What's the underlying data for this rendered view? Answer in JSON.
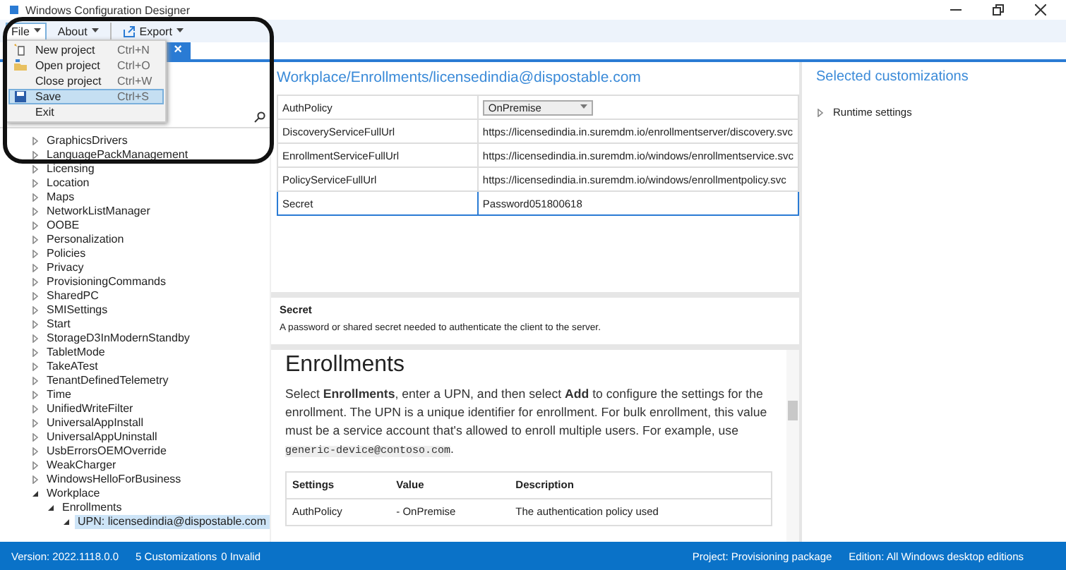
{
  "window": {
    "title": "Windows Configuration Designer"
  },
  "menu_bar": [
    {
      "label": "File",
      "selected": true
    },
    {
      "label": "About",
      "selected": false
    },
    {
      "label": "Export",
      "selected": false
    }
  ],
  "file_menu": [
    {
      "label": "New project",
      "shortcut": "Ctrl+N",
      "selected": false
    },
    {
      "label": "Open project",
      "shortcut": "Ctrl+O",
      "selected": false
    },
    {
      "label": "Close project",
      "shortcut": "Ctrl+W",
      "selected": false
    },
    {
      "label": "Save",
      "shortcut": "Ctrl+S",
      "selected": true
    },
    {
      "label": "Exit",
      "selected": false
    }
  ],
  "tab": {
    "close": "×"
  },
  "tree": [
    {
      "label": "GraphicsDrivers",
      "expanded": false
    },
    {
      "label": "LanguagePackManagement",
      "expanded": false
    },
    {
      "label": "Licensing",
      "expanded": false
    },
    {
      "label": "Location",
      "expanded": false
    },
    {
      "label": "Maps",
      "expanded": false
    },
    {
      "label": "NetworkListManager",
      "expanded": false
    },
    {
      "label": "OOBE",
      "expanded": false
    },
    {
      "label": "Personalization",
      "expanded": false
    },
    {
      "label": "Policies",
      "expanded": false
    },
    {
      "label": "Privacy",
      "expanded": false
    },
    {
      "label": "ProvisioningCommands",
      "expanded": false
    },
    {
      "label": "SharedPC",
      "expanded": false
    },
    {
      "label": "SMISettings",
      "expanded": false
    },
    {
      "label": "Start",
      "expanded": false
    },
    {
      "label": "StorageD3InModernStandby",
      "expanded": false
    },
    {
      "label": "TabletMode",
      "expanded": false
    },
    {
      "label": "TakeATest",
      "expanded": false
    },
    {
      "label": "TenantDefinedTelemetry",
      "expanded": false
    },
    {
      "label": "Time",
      "expanded": false
    },
    {
      "label": "UnifiedWriteFilter",
      "expanded": false
    },
    {
      "label": "UniversalAppInstall",
      "expanded": false
    },
    {
      "label": "UniversalAppUninstall",
      "expanded": false
    },
    {
      "label": "UsbErrorsOEMOverride",
      "expanded": false
    },
    {
      "label": "WeakCharger",
      "expanded": false
    },
    {
      "label": "WindowsHelloForBusiness",
      "expanded": false
    },
    {
      "label": "Workplace",
      "expanded": true,
      "children": [
        {
          "label": "Enrollments",
          "expanded": true,
          "children": [
            {
              "label": "UPN: licensedindia@dispostable.com",
              "expanded": true,
              "selected": true
            }
          ]
        }
      ]
    }
  ],
  "settings": {
    "path": "Workplace/Enrollments/licensedindia@dispostable.com",
    "rows": [
      {
        "name": "AuthPolicy",
        "value": "OnPremise",
        "kind": "dropdown",
        "selected": false
      },
      {
        "name": "DiscoveryServiceFullUrl",
        "value": "https://licensedindia.in.suremdm.io/enrollmentserver/discovery.svc",
        "kind": "text",
        "selected": false
      },
      {
        "name": "EnrollmentServiceFullUrl",
        "value": "https://licensedindia.in.suremdm.io/windows/enrollmentservice.svc",
        "kind": "text",
        "selected": false
      },
      {
        "name": "PolicyServiceFullUrl",
        "value": "https://licensedindia.in.suremdm.io/windows/enrollmentpolicy.svc",
        "kind": "text",
        "selected": false
      },
      {
        "name": "Secret",
        "value": "Password051800618",
        "kind": "text",
        "selected": true
      }
    ]
  },
  "description": {
    "title": "Secret",
    "text": "A password or shared secret needed to authenticate the client to the server."
  },
  "doc": {
    "heading": "Enrollments",
    "paragraph": "Select **Enrollments**, enter a UPN, and then select **Add** to configure the settings for the enrollment. The UPN is a unique identifier for enrollment. For bulk enrollment, this value must be a service account that's allowed to enroll multiple users. For example, use",
    "code": "generic-device@contoso.com",
    "paragraph_end": ".",
    "table": {
      "columns": [
        "Settings",
        "Value",
        "Description"
      ],
      "rows": [
        [
          "AuthPolicy",
          "- OnPremise",
          "The authentication policy used"
        ]
      ]
    }
  },
  "customizations": {
    "title": "Selected customizations",
    "items": [
      {
        "label": "Runtime settings",
        "expanded": false
      }
    ]
  },
  "status_bar": {
    "version": "Version: 2022.1118.0.0",
    "customizations": "5 Customizations",
    "invalid": "0 Invalid",
    "project": "Project: Provisioning package",
    "edition": "Edition: All Windows desktop editions"
  }
}
